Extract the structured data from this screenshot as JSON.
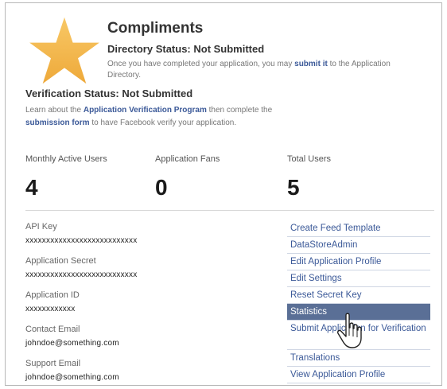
{
  "app": {
    "title": "Compliments"
  },
  "directory": {
    "status": "Directory Status: Not Submitted",
    "desc_before": "Once you have completed your application, you may ",
    "desc_link": "submit it",
    "desc_after": " to the Application Directory."
  },
  "verification": {
    "status": "Verification Status: Not Submitted",
    "desc_before": "Learn about the ",
    "program_link": "Application Verification Program",
    "desc_middle": " then complete the ",
    "form_link": "submission form",
    "desc_after": " to have Facebook verify your application."
  },
  "stats": [
    {
      "label": "Monthly Active Users",
      "value": "4"
    },
    {
      "label": "Application Fans",
      "value": "0"
    },
    {
      "label": "Total Users",
      "value": "5"
    }
  ],
  "fields": [
    {
      "label": "API Key",
      "value": "xxxxxxxxxxxxxxxxxxxxxxxxxxx"
    },
    {
      "label": "Application Secret",
      "value": "xxxxxxxxxxxxxxxxxxxxxxxxxxx"
    },
    {
      "label": "Application ID",
      "value": "xxxxxxxxxxxx"
    },
    {
      "label": "Contact Email",
      "value": "johndoe@something.com"
    },
    {
      "label": "Support Email",
      "value": "johndoe@something.com"
    }
  ],
  "side_links": [
    "Create Feed Template",
    "DataStoreAdmin",
    "Edit Application Profile",
    "Edit Settings",
    "Reset Secret Key",
    "Statistics",
    "Submit Application for Verification",
    "Translations",
    "View Application Profile"
  ],
  "colors": {
    "star": "#f5b84a",
    "link": "#3b5998",
    "active_bg": "#5a6f96"
  },
  "icons": {
    "app_icon": "star-icon",
    "pointer": "hand-cursor-icon"
  }
}
